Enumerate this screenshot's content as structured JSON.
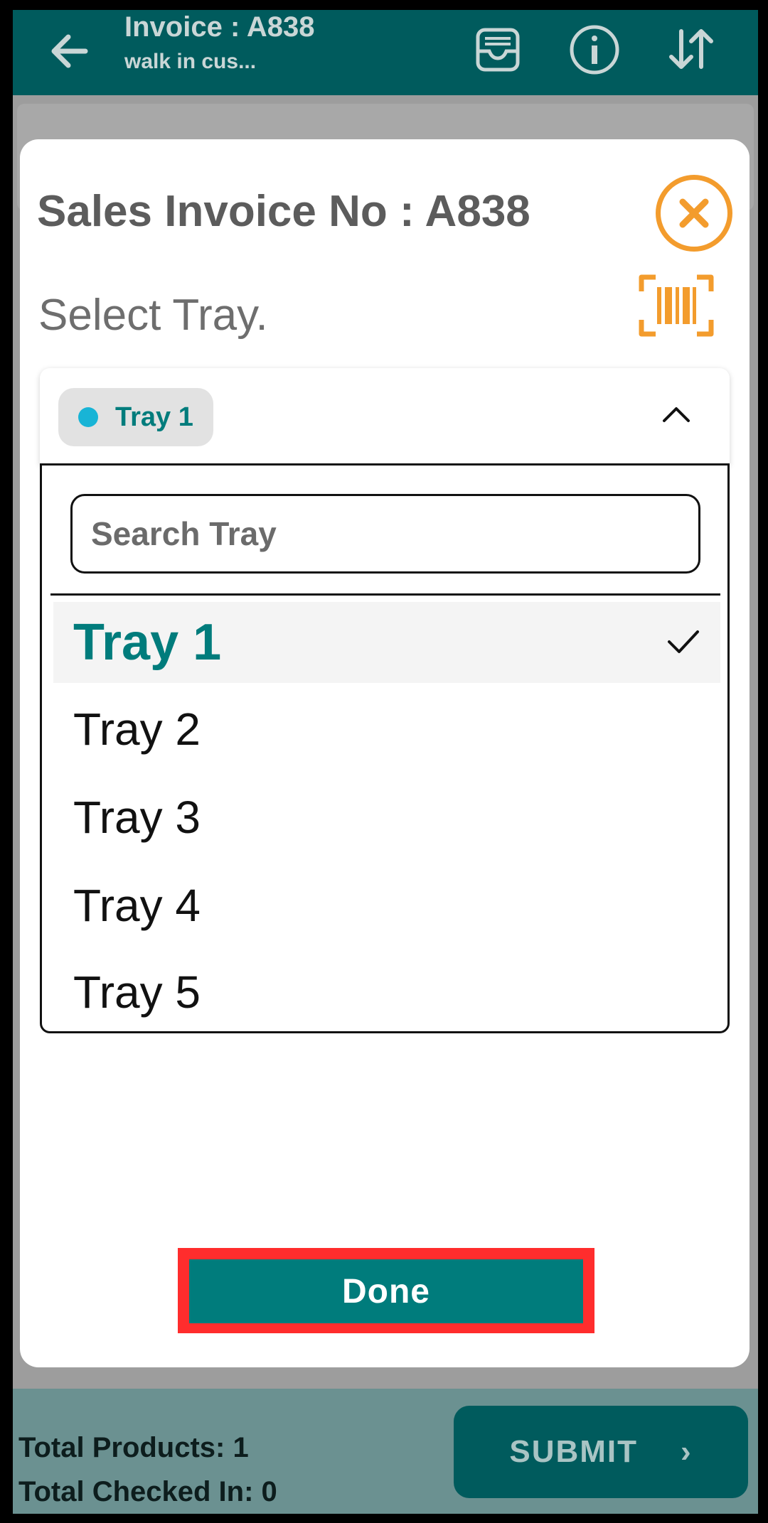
{
  "header": {
    "title": "Invoice : A838",
    "subtitle": "walk in cus...",
    "icons": [
      "back-arrow-icon",
      "tray-icon",
      "info-icon",
      "sort-icon"
    ]
  },
  "modal": {
    "title": "Sales Invoice No : A838",
    "select_label": "Select Tray.",
    "selected_chip": "Tray 1",
    "search_placeholder": "Search Tray",
    "options": [
      {
        "label": "Tray 1",
        "selected": true
      },
      {
        "label": "Tray 2",
        "selected": false
      },
      {
        "label": "Tray 3",
        "selected": false
      },
      {
        "label": "Tray 4",
        "selected": false
      },
      {
        "label": "Tray 5",
        "selected": false
      }
    ],
    "done_label": "Done"
  },
  "bottom": {
    "total_products": "Total Products: 1",
    "total_checked_in": "Total Checked In: 0",
    "submit_label": "SUBMIT"
  },
  "colors": {
    "primary": "#007c7c",
    "accent": "#f39c2d",
    "highlight": "#ff2d2d",
    "chip_dot": "#18b4d6"
  }
}
